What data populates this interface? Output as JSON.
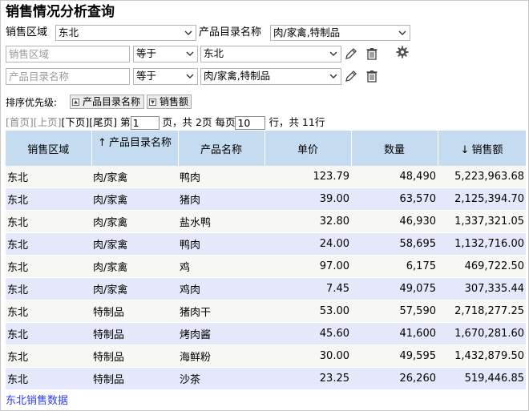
{
  "title": "销售情况分析查询",
  "filters": {
    "region_label": "销售区域",
    "region_value": "东北",
    "category_label": "产品目录名称",
    "category_value": "肉/家禽,特制品",
    "rows": [
      {
        "field_placeholder": "销售区域",
        "operator": "等于",
        "value": "东北"
      },
      {
        "field_placeholder": "产品目录名称",
        "operator": "等于",
        "value": "肉/家禽,特制品"
      }
    ]
  },
  "sort": {
    "label": "排序优先级:",
    "items": [
      "产品目录名称",
      "销售额"
    ]
  },
  "pager": {
    "first": "[首页]",
    "prev": "[上页]",
    "next": "[下页]",
    "last": "[尾页]",
    "page_prefix": "第",
    "current_page": "1",
    "page_suffix": "页，共 2页 每页",
    "per_page": "10",
    "rows_suffix": "行，共 11行"
  },
  "table": {
    "columns": [
      {
        "label": "销售区域",
        "sort": ""
      },
      {
        "label": "产品目录名称",
        "sort": "↑"
      },
      {
        "label": "产品名称",
        "sort": ""
      },
      {
        "label": "单价",
        "sort": ""
      },
      {
        "label": "数量",
        "sort": ""
      },
      {
        "label": "销售额",
        "sort": "↓"
      }
    ],
    "rows": [
      [
        "东北",
        "肉/家禽",
        "鸭肉",
        "123.79",
        "48,490",
        "5,223,963.68"
      ],
      [
        "东北",
        "肉/家禽",
        "猪肉",
        "39.00",
        "63,570",
        "2,125,394.70"
      ],
      [
        "东北",
        "肉/家禽",
        "盐水鸭",
        "32.80",
        "46,930",
        "1,337,321.05"
      ],
      [
        "东北",
        "肉/家禽",
        "鸭肉",
        "24.00",
        "58,695",
        "1,132,716.00"
      ],
      [
        "东北",
        "肉/家禽",
        "鸡",
        "97.00",
        "6,175",
        "469,722.50"
      ],
      [
        "东北",
        "肉/家禽",
        "鸡肉",
        "7.45",
        "49,075",
        "307,335.44"
      ],
      [
        "东北",
        "特制品",
        "猪肉干",
        "53.00",
        "57,590",
        "2,718,277.25"
      ],
      [
        "东北",
        "特制品",
        "烤肉酱",
        "45.60",
        "41,600",
        "1,670,281.60"
      ],
      [
        "东北",
        "特制品",
        "海鲜粉",
        "30.00",
        "49,595",
        "1,432,879.50"
      ],
      [
        "东北",
        "特制品",
        "沙茶",
        "23.25",
        "26,260",
        "519,446.85"
      ]
    ]
  },
  "footer_link": "东北销售数据",
  "icons": {
    "edit": "pencil-icon",
    "delete": "trash-icon",
    "settings": "gear-icon",
    "dropdown": "chevron-down-icon"
  }
}
